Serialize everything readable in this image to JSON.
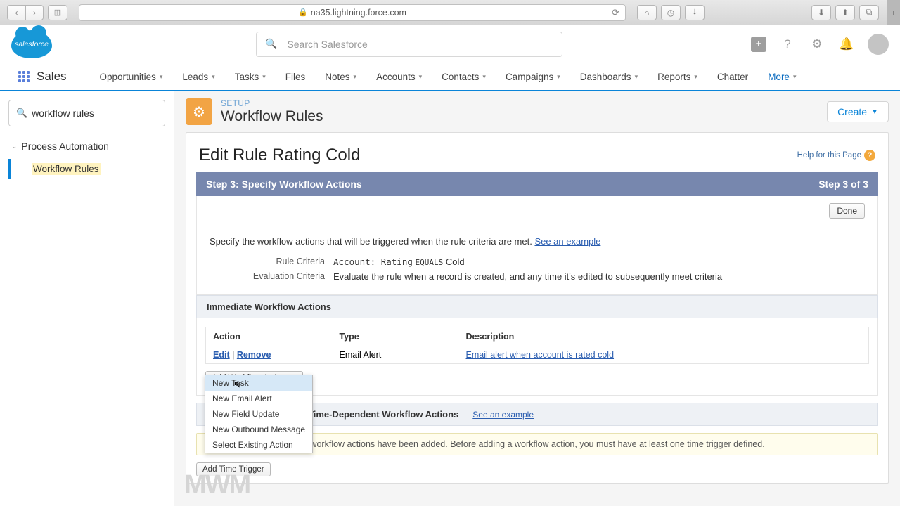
{
  "browser": {
    "url": "na35.lightning.force.com",
    "icons": {
      "back": "‹",
      "forward": "›",
      "sidebar": "▥",
      "reload": "⟳",
      "home": "⌂",
      "clock": "◷",
      "download_tray": "⤓",
      "dl_circle": "⬇",
      "share": "⬆",
      "tabs": "⧉",
      "plus": "+"
    }
  },
  "header": {
    "logo_text": "salesforce",
    "search_placeholder": "Search Salesforce",
    "icons": {
      "plus": "+",
      "help": "?",
      "gear": "⚙",
      "bell": "🔔"
    }
  },
  "nav": {
    "app_name": "Sales",
    "items": [
      "Opportunities",
      "Leads",
      "Tasks",
      "Files",
      "Notes",
      "Accounts",
      "Contacts",
      "Campaigns",
      "Dashboards",
      "Reports",
      "Chatter",
      "More"
    ],
    "no_caret": [
      "Files",
      "Chatter"
    ]
  },
  "sidebar": {
    "search_value": "workflow rules",
    "category": "Process Automation",
    "leaf": "Workflow Rules"
  },
  "page": {
    "crumb": "SETUP",
    "title": "Workflow Rules",
    "create": "Create",
    "rule_title": "Edit Rule Rating Cold",
    "help": "Help for this Page",
    "step_left": "Step 3: Specify Workflow Actions",
    "step_right": "Step 3 of 3",
    "done": "Done",
    "desc_text": "Specify the workflow actions that will be triggered when the rule criteria are met. ",
    "see_example": "See an example",
    "rule_criteria_label": "Rule Criteria",
    "rule_criteria_value_pre": "Account: Rating",
    "rule_criteria_value_op": "EQUALS",
    "rule_criteria_value_post": "Cold",
    "eval_label": "Evaluation Criteria",
    "eval_value": "Evaluate the rule when a record is created, and any time it's edited to subsequently meet criteria",
    "immediate_head": "Immediate Workflow Actions",
    "cols": {
      "action": "Action",
      "type": "Type",
      "desc": "Description"
    },
    "row": {
      "edit": "Edit",
      "remove": "Remove",
      "type": "Email Alert",
      "desc": "Email alert when account is rated cold"
    },
    "add_action": "Add Workflow Action",
    "menu": [
      "New Task",
      "New Email Alert",
      "New Field Update",
      "New Outbound Message",
      "Select Existing Action"
    ],
    "time_head": "Time-Dependent Workflow Actions",
    "warn_label": "",
    "warn_text": "No workflow actions have been added. Before adding a workflow action, you must have at least one time trigger defined.",
    "add_trigger": "Add Time Trigger"
  },
  "watermark": "MWM"
}
